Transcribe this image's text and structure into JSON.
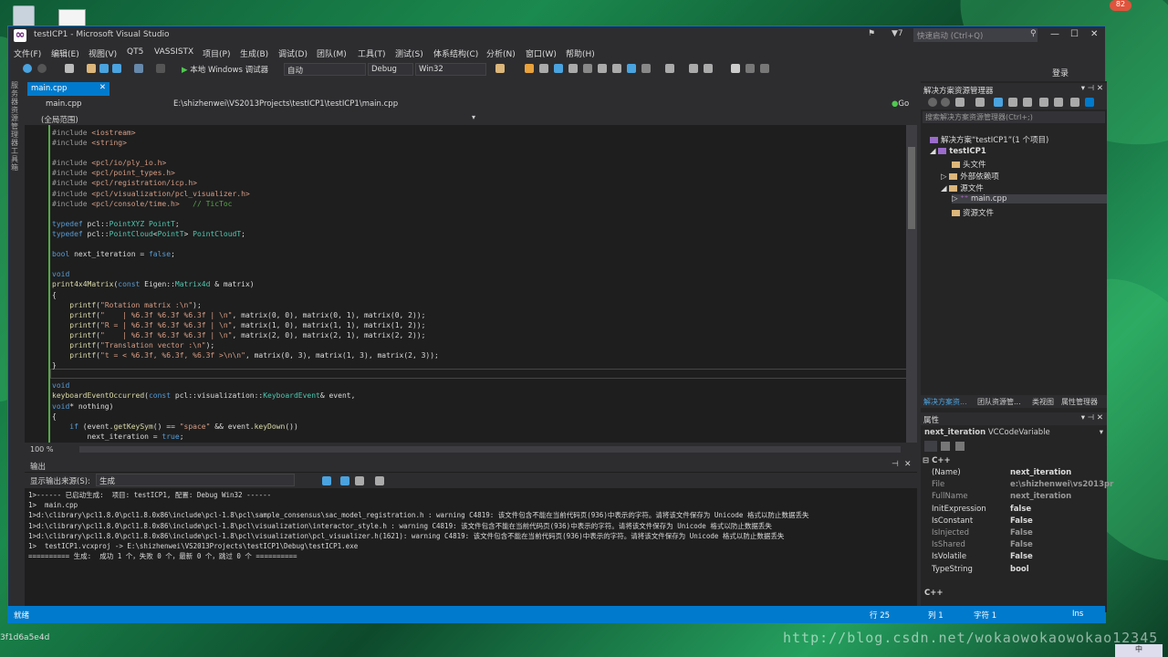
{
  "desktop": {
    "badge": "82",
    "bottom_text": "3f1d6a5e4d",
    "watermark": "http://blog.csdn.net/wokaowokaowokao12345"
  },
  "window": {
    "title": "testICP1 - Microsoft Visual Studio",
    "flag_count": "7",
    "quick_launch": "快速启动 (Ctrl+Q)",
    "sign_in": "登录"
  },
  "menu": [
    "文件(F)",
    "编辑(E)",
    "视图(V)",
    "QT5",
    "VASSISTX",
    "项目(P)",
    "生成(B)",
    "调试(D)",
    "团队(M)",
    "工具(T)",
    "测试(S)",
    "体系结构(C)",
    "分析(N)",
    "窗口(W)",
    "帮助(H)"
  ],
  "toolbar": {
    "start": "本地 Windows 调试器",
    "mode": "自动",
    "config": "Debug",
    "platform": "Win32"
  },
  "left_tabs": "服务器资源管理器 工具箱",
  "editor": {
    "tab": "main.cpp",
    "file_combo": "main.cpp",
    "path": "E:\\shizhenwei\\VS2013Projects\\testICP1\\testICP1\\main.cpp",
    "go": "Go",
    "scope": "(全局范围)",
    "zoom": "100 %",
    "lines": [
      "#include <iostream>",
      "#include <string>",
      "",
      "#include <pcl/io/ply_io.h>",
      "#include <pcl/point_types.h>",
      "#include <pcl/registration/icp.h>",
      "#include <pcl/visualization/pcl_visualizer.h>",
      "#include <pcl/console/time.h>   // TicToc",
      "",
      "typedef pcl::PointXYZ PointT;",
      "typedef pcl::PointCloud<PointT> PointCloudT;",
      "",
      "bool next_iteration = false;",
      "",
      "void",
      "print4x4Matrix(const Eigen::Matrix4d & matrix)",
      "{",
      "    printf(\"Rotation matrix :\\n\");",
      "    printf(\"    | %6.3f %6.3f %6.3f | \\n\", matrix(0, 0), matrix(0, 1), matrix(0, 2));",
      "    printf(\"R = | %6.3f %6.3f %6.3f | \\n\", matrix(1, 0), matrix(1, 1), matrix(1, 2));",
      "    printf(\"    | %6.3f %6.3f %6.3f | \\n\", matrix(2, 0), matrix(2, 1), matrix(2, 2));",
      "    printf(\"Translation vector :\\n\");",
      "    printf(\"t = < %6.3f, %6.3f, %6.3f >\\n\\n\", matrix(0, 3), matrix(1, 3), matrix(2, 3));",
      "}",
      "",
      "void",
      "keyboardEventOccurred(const pcl::visualization::KeyboardEvent& event,",
      "void* nothing)",
      "{",
      "    if (event.getKeySym() == \"space\" && event.keyDown())",
      "        next_iteration = true;",
      "}"
    ]
  },
  "output": {
    "title": "输出",
    "source_label": "显示输出来源(S):",
    "source_value": "生成",
    "lines": [
      "1>------ 已启动生成:  项目: testICP1, 配置: Debug Win32 ------",
      "1>  main.cpp",
      "1>d:\\clibrary\\pcl1.8.0\\pcl1.8.0x86\\include\\pcl-1.8\\pcl\\sample_consensus\\sac_model_registration.h : warning C4819: 该文件包含不能在当前代码页(936)中表示的字符。请将该文件保存为 Unicode 格式以防止数据丢失",
      "1>d:\\clibrary\\pcl1.8.0\\pcl1.8.0x86\\include\\pcl-1.8\\pcl\\visualization\\interactor_style.h : warning C4819: 该文件包含不能在当前代码页(936)中表示的字符。请将该文件保存为 Unicode 格式以防止数据丢失",
      "1>d:\\clibrary\\pcl1.8.0\\pcl1.8.0x86\\include\\pcl-1.8\\pcl\\visualization\\pcl_visualizer.h(1621): warning C4819: 该文件包含不能在当前代码页(936)中表示的字符。请将该文件保存为 Unicode 格式以防止数据丢失",
      "1>  testICP1.vcxproj -> E:\\shizhenwei\\VS2013Projects\\testICP1\\Debug\\testICP1.exe",
      "========== 生成:  成功 1 个，失败 0 个，最新 0 个，跳过 0 个 =========="
    ]
  },
  "solution_explorer": {
    "title": "解决方案资源管理器",
    "search": "搜索解决方案资源管理器(Ctrl+;)",
    "solution": "解决方案“testICP1”(1 个项目)",
    "project": "testICP1",
    "folders": [
      "头文件",
      "外部依赖项",
      "源文件"
    ],
    "file": "main.cpp",
    "res": "资源文件",
    "tabs": [
      "解决方案资...",
      "团队资源管...",
      "类视图",
      "属性管理器"
    ]
  },
  "properties": {
    "title": "属性",
    "object": "next_iteration",
    "object_type": "VCCodeVariable",
    "group": "C++",
    "rows": [
      {
        "name": "(Name)",
        "value": "next_iteration"
      },
      {
        "name": "File",
        "value": "e:\\shizhenwei\\vs2013pr"
      },
      {
        "name": "FullName",
        "value": "next_iteration"
      },
      {
        "name": "InitExpression",
        "value": "false"
      },
      {
        "name": "IsConstant",
        "value": "False"
      },
      {
        "name": "IsInjected",
        "value": "False"
      },
      {
        "name": "IsShared",
        "value": "False"
      },
      {
        "name": "IsVolatile",
        "value": "False"
      },
      {
        "name": "TypeString",
        "value": "bool"
      }
    ],
    "footer": "C++"
  },
  "status": {
    "ready": "就绪",
    "line": "行 25",
    "col": "列 1",
    "char": "字符 1",
    "ins": "Ins"
  },
  "colors": {
    "accent": "#007acc",
    "bg": "#2d2d30",
    "editor": "#1e1e1e"
  }
}
